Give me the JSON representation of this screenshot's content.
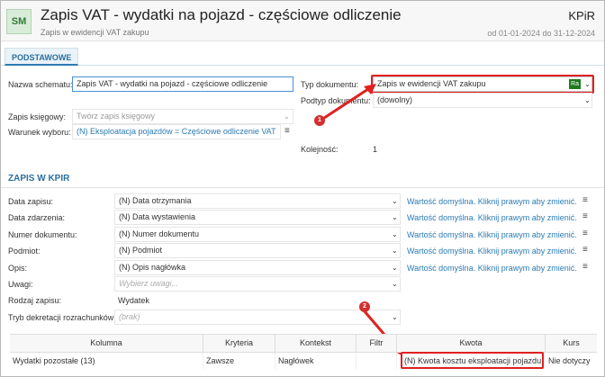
{
  "header": {
    "logo": "SM",
    "title": "Zapis VAT - wydatki na pojazd - częściowe odliczenie",
    "subtitle": "Zapis w ewidencji VAT zakupu",
    "module": "KPiR",
    "period": "od 01-01-2024 do 31-12-2024"
  },
  "tabs": [
    {
      "label": "PODSTAWOWE"
    }
  ],
  "basic": {
    "name_label": "Nazwa schematu:",
    "name_value": "Zapis VAT - wydatki na pojazd - częściowe odliczenie",
    "doc_type_label": "Typ dokumentu:",
    "doc_type_value": "Zapis w ewidencji VAT zakupu",
    "doc_type_badge": "Ra",
    "subtype_label": "Podtyp dokumentu:",
    "subtype_value": "(dowolny)",
    "book_entry_label": "Zapis księgowy:",
    "book_entry_placeholder": "Twórz zapis księgowy",
    "condition_label": "Warunek wyboru:",
    "condition_value": "(N) Eksploatacja pojazdów = Częściowe odliczenie VAT",
    "order_label": "Kolejność:",
    "order_value": "1"
  },
  "kpir": {
    "section_title": "ZAPIS W KPIR",
    "default_hint": "Wartość domyślna. Kliknij prawym aby zmienić.",
    "rows": [
      {
        "label": "Data zapisu:",
        "value": "(N) Data otrzymania"
      },
      {
        "label": "Data zdarzenia:",
        "value": "(N) Data wystawienia"
      },
      {
        "label": "Numer dokumentu:",
        "value": "(N) Numer dokumentu"
      },
      {
        "label": "Podmiot:",
        "value": "(N) Podmiot"
      },
      {
        "label": "Opis:",
        "value": "(N) Opis nagłówka"
      }
    ],
    "notes_label": "Uwagi:",
    "notes_placeholder": "Wybierz uwagi...",
    "type_label": "Rodzaj zapisu:",
    "type_value": "Wydatek",
    "settlement_label": "Tryb dekretacji rozrachunków:",
    "settlement_placeholder": "(brak)"
  },
  "annotations": {
    "one": "1",
    "two": "2"
  },
  "table": {
    "headers": [
      "Kolumna",
      "Kryteria",
      "Kontekst",
      "Filtr",
      "Kwota",
      "Kurs"
    ],
    "rows": [
      [
        "Wydatki pozostałe (13)",
        "Zawsze",
        "Nagłówek",
        "",
        "(N) Kwota kosztu eksploatacji pojazdu",
        "Nie dotyczy"
      ]
    ]
  },
  "icons": {
    "dropdown": "chevron-down-icon",
    "menu": "hamburger-icon"
  },
  "colors": {
    "accent": "#2b7bb3",
    "highlight": "#e02020",
    "logo_bg": "#d9ecd9"
  }
}
